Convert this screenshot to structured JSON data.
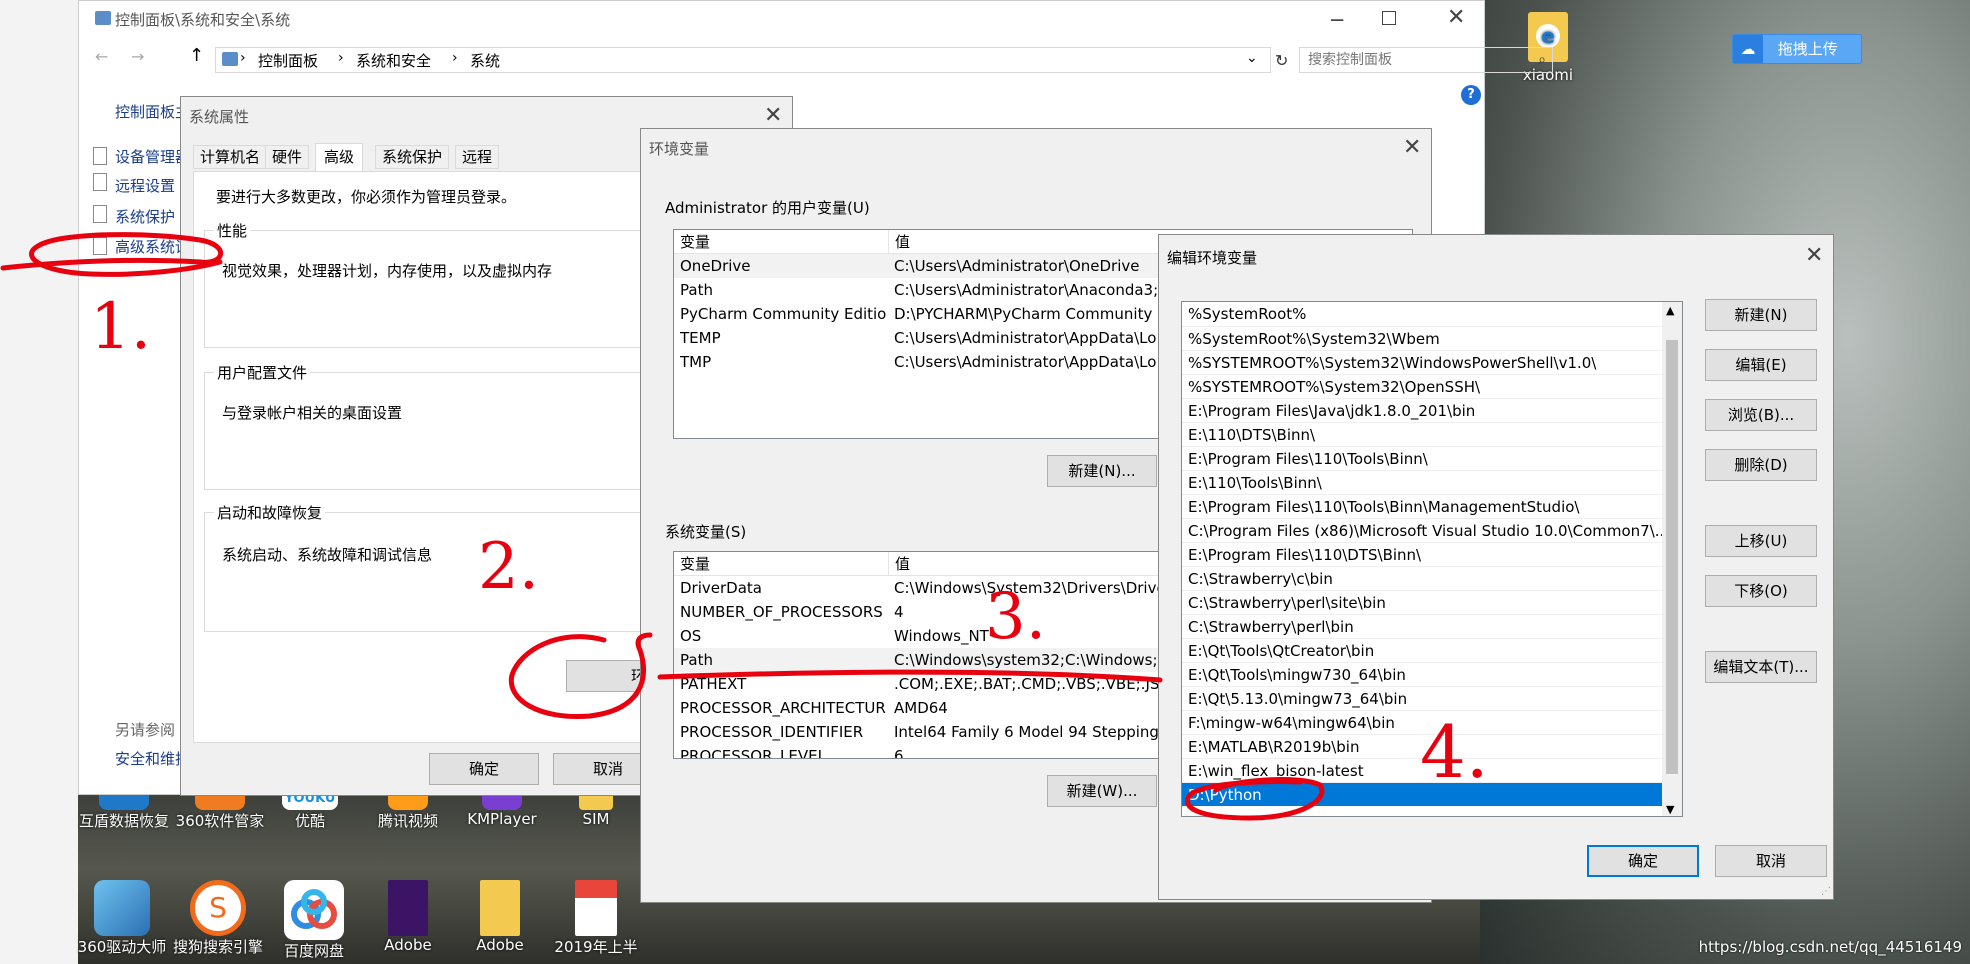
{
  "desktop": {
    "top_right_icon": "xiaomi",
    "upload_button": "拖拽上传",
    "watermark": "https://blog.csdn.net/qq_44516149",
    "taskbar_row1": [
      "互盾数据恢复",
      "360软件管家",
      "优酷",
      "腾讯视频",
      "KMPlayer",
      "SIM"
    ],
    "taskbar_row2": [
      "360驱动大师",
      "搜狗搜索引擎",
      "百度网盘",
      "Adobe",
      "Adobe",
      "2019年上半"
    ],
    "logo_youku": "YOUKU"
  },
  "control_panel": {
    "title": "控制面板\\系统和安全\\系统",
    "breadcrumb": [
      "控制面板",
      "系统和安全",
      "系统"
    ],
    "search_placeholder": "搜索控制面板",
    "home_link": "控制面板主",
    "left_links": [
      "设备管理器",
      "远程设置",
      "系统保护",
      "高级系统设"
    ],
    "see_also": "另请参阅",
    "security_link": "安全和维护",
    "help_glyph": "?"
  },
  "system_properties": {
    "title": "系统属性",
    "tabs": [
      "计算机名",
      "硬件",
      "高级",
      "系统保护",
      "远程"
    ],
    "active_tab": "高级",
    "admin_note": "要进行大多数更改，你必须作为管理员登录。",
    "perf_label": "性能",
    "perf_text": "视觉效果，处理器计划，内存使用，以及虚拟内存",
    "profile_label": "用户配置文件",
    "profile_text": "与登录帐户相关的桌面设置",
    "startup_label": "启动和故障恢复",
    "startup_text": "系统启动、系统故障和调试信息",
    "env_button": "环境",
    "ok": "确定",
    "cancel": "取消"
  },
  "env_vars": {
    "title": "环境变量",
    "user_label": "Administrator 的用户变量(U)",
    "col_var": "变量",
    "col_val": "值",
    "user_rows": [
      {
        "name": "OneDrive",
        "value": "C:\\Users\\Administrator\\OneDrive"
      },
      {
        "name": "Path",
        "value": "C:\\Users\\Administrator\\Anaconda3;C"
      },
      {
        "name": "PyCharm Community Edition",
        "value": "D:\\PYCHARM\\PyCharm Community I"
      },
      {
        "name": "TEMP",
        "value": "C:\\Users\\Administrator\\AppData\\Lo"
      },
      {
        "name": "TMP",
        "value": "C:\\Users\\Administrator\\AppData\\Lo"
      }
    ],
    "user_new": "新建(N)...",
    "sys_label": "系统变量(S)",
    "sys_rows": [
      {
        "name": "DriverData",
        "value": "C:\\Windows\\System32\\Drivers\\Drive"
      },
      {
        "name": "NUMBER_OF_PROCESSORS",
        "value": "4"
      },
      {
        "name": "OS",
        "value": "Windows_NT"
      },
      {
        "name": "Path",
        "value": "C:\\Windows\\system32;C:\\Windows;C"
      },
      {
        "name": "PATHEXT",
        "value": ".COM;.EXE;.BAT;.CMD;.VBS;.VBE;.JS;."
      },
      {
        "name": "PROCESSOR_ARCHITECTURE",
        "value": "AMD64"
      },
      {
        "name": "PROCESSOR_IDENTIFIER",
        "value": "Intel64 Family 6 Model 94 Stepping"
      },
      {
        "name": "PROCESSOR_LEVEL",
        "value": "6"
      }
    ],
    "sys_new": "新建(W)..."
  },
  "edit_env": {
    "title": "编辑环境变量",
    "entries": [
      "%SystemRoot%",
      "%SystemRoot%\\System32\\Wbem",
      "%SYSTEMROOT%\\System32\\WindowsPowerShell\\v1.0\\",
      "%SYSTEMROOT%\\System32\\OpenSSH\\",
      "E:\\Program Files\\Java\\jdk1.8.0_201\\bin",
      "E:\\110\\DTS\\Binn\\",
      "E:\\Program Files\\110\\Tools\\Binn\\",
      "E:\\110\\Tools\\Binn\\",
      "E:\\Program Files\\110\\Tools\\Binn\\ManagementStudio\\",
      "C:\\Program Files (x86)\\Microsoft Visual Studio 10.0\\Common7\\...",
      "E:\\Program Files\\110\\DTS\\Binn\\",
      "C:\\Strawberry\\c\\bin",
      "C:\\Strawberry\\perl\\site\\bin",
      "C:\\Strawberry\\perl\\bin",
      "E:\\Qt\\Tools\\QtCreator\\bin",
      "E:\\Qt\\Tools\\mingw730_64\\bin",
      "E:\\Qt\\5.13.0\\mingw73_64\\bin",
      "F:\\mingw-w64\\mingw64\\bin",
      "E:\\MATLAB\\R2019b\\bin",
      "E:\\win_flex_bison-latest",
      "D:\\Python"
    ],
    "selected_index": 20,
    "buttons": [
      "新建(N)",
      "编辑(E)",
      "浏览(B)...",
      "删除(D)",
      "上移(U)",
      "下移(O)",
      "编辑文本(T)..."
    ],
    "ok": "确定",
    "cancel": "取消"
  },
  "annotations": [
    "1.",
    "2.",
    "3.",
    "4."
  ],
  "colors": {
    "annotation": "#e8000f",
    "selection": "#0078d7"
  }
}
